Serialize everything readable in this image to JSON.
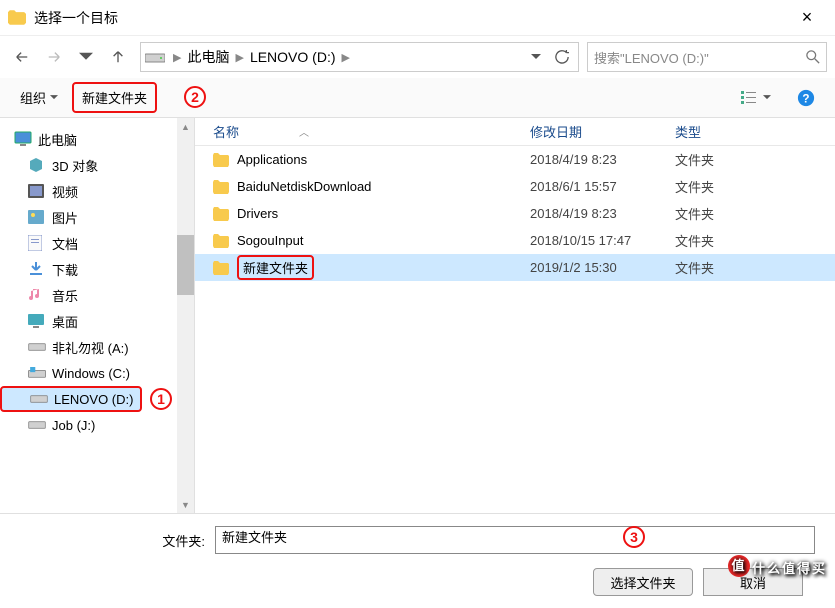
{
  "title": "选择一个目标",
  "breadcrumb": {
    "seg1": "此电脑",
    "seg2": "LENOVO (D:)"
  },
  "search_placeholder": "搜索\"LENOVO (D:)\"",
  "toolbar": {
    "organize": "组织",
    "new_folder": "新建文件夹"
  },
  "annotations": {
    "n1": "1",
    "n2": "2",
    "n3": "3"
  },
  "tree": {
    "root": "此电脑",
    "items": [
      {
        "label": "3D 对象"
      },
      {
        "label": "视频"
      },
      {
        "label": "图片"
      },
      {
        "label": "文档"
      },
      {
        "label": "下载"
      },
      {
        "label": "音乐"
      },
      {
        "label": "桌面"
      },
      {
        "label": "非礼勿视 (A:)"
      },
      {
        "label": "Windows (C:)"
      },
      {
        "label": "LENOVO (D:)"
      },
      {
        "label": "Job (J:)"
      }
    ]
  },
  "columns": {
    "name": "名称",
    "date": "修改日期",
    "type": "类型"
  },
  "rows": [
    {
      "name": "Applications",
      "date": "2018/4/19 8:23",
      "type": "文件夹"
    },
    {
      "name": "BaiduNetdiskDownload",
      "date": "2018/6/1 15:57",
      "type": "文件夹"
    },
    {
      "name": "Drivers",
      "date": "2018/4/19 8:23",
      "type": "文件夹"
    },
    {
      "name": "SogouInput",
      "date": "2018/10/15 17:47",
      "type": "文件夹"
    },
    {
      "name": "新建文件夹",
      "date": "2019/1/2 15:30",
      "type": "文件夹"
    }
  ],
  "footer": {
    "label": "文件夹:",
    "value": "新建文件夹",
    "select": "选择文件夹",
    "cancel": "取消"
  },
  "watermark": "什么值得买"
}
